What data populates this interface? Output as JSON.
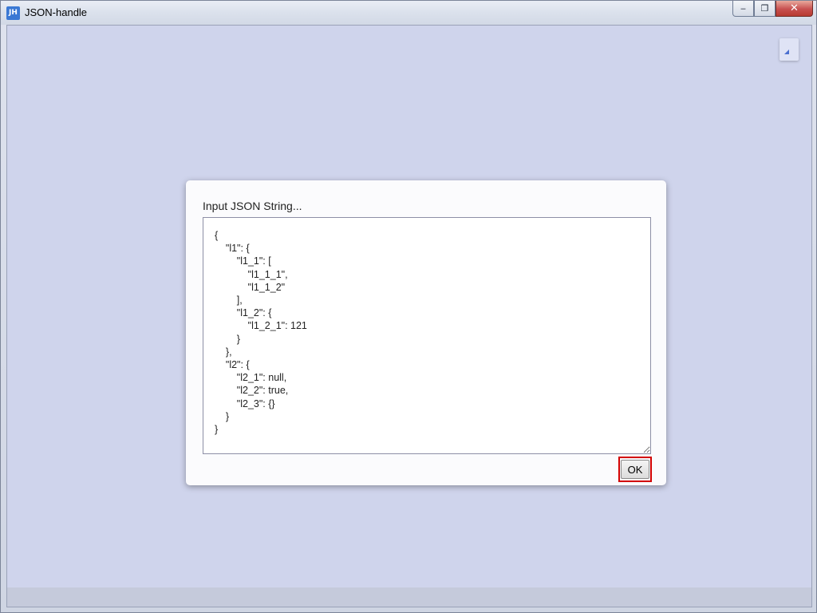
{
  "window": {
    "icon_text": "JH",
    "title": "JSON-handle",
    "controls": {
      "minimize": "‒",
      "restore": "❐",
      "close": "✕"
    }
  },
  "dialog": {
    "label": "Input JSON String...",
    "json_value": "{\n    \"l1\": {\n        \"l1_1\": [\n            \"l1_1_1\",\n            \"l1_1_2\"\n        ],\n        \"l1_2\": {\n            \"l1_2_1\": 121\n        }\n    },\n    \"l2\": {\n        \"l2_1\": null,\n        \"l2_2\": true,\n        \"l2_3\": {}\n    }\n}",
    "ok_label": "OK"
  },
  "colors": {
    "client_background": "#cfd4ec",
    "dialog_background": "#fbfbfd",
    "highlight_border": "#d20000"
  },
  "icons": {
    "app": "json-handle-app-icon",
    "corner": "corner-triangle-icon"
  }
}
